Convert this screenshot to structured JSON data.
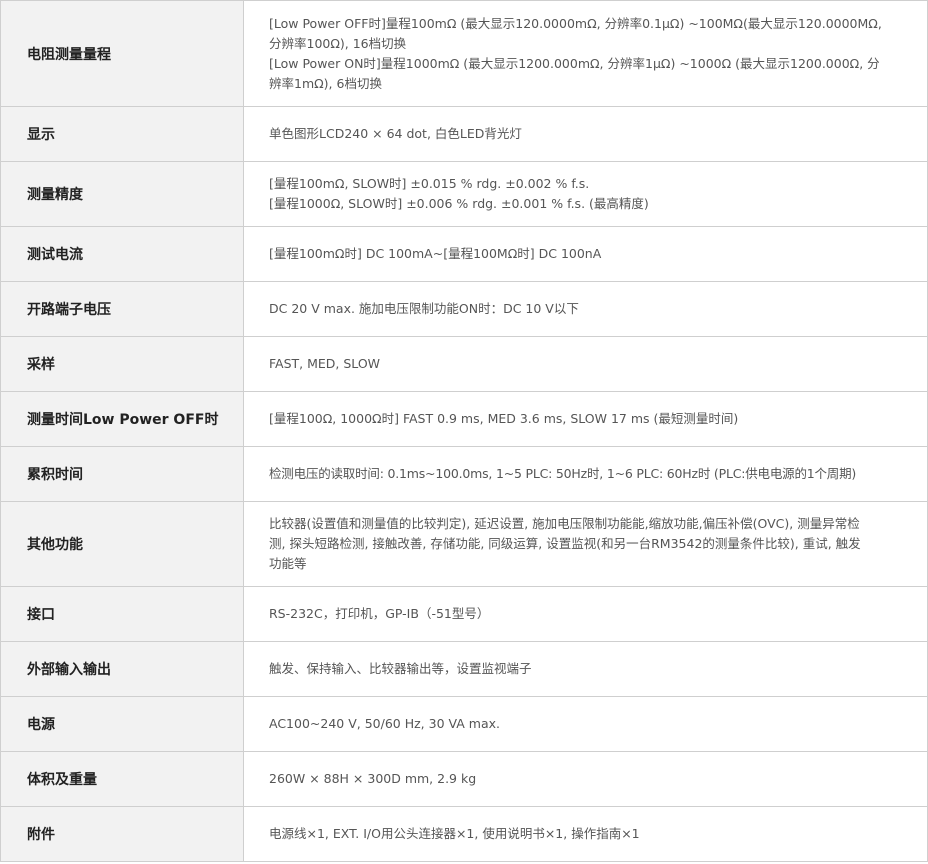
{
  "rows": [
    {
      "label": "电阻测量量程",
      "lines": [
        "[Low Power OFF时]量程100mΩ (最大显示120.0000mΩ, 分辨率0.1μΩ) ~100MΩ(最大显示120.0000MΩ,",
        "分辨率100Ω), 16档切换",
        "[Low Power ON时]量程1000mΩ (最大显示1200.000mΩ, 分辨率1μΩ) ~1000Ω (最大显示1200.000Ω, 分",
        "辨率1mΩ), 6档切换"
      ]
    },
    {
      "label": "显示",
      "lines": [
        "单色图形LCD240 × 64 dot, 白色LED背光灯"
      ]
    },
    {
      "label": "测量精度",
      "lines": [
        "[量程100mΩ, SLOW时] ±0.015 % rdg. ±0.002 % f.s.",
        "[量程1000Ω, SLOW时] ±0.006 % rdg. ±0.001 % f.s. (最高精度)"
      ]
    },
    {
      "label": "测试电流",
      "lines": [
        "[量程100mΩ时] DC 100mA~[量程100MΩ时] DC 100nA"
      ]
    },
    {
      "label": "开路端子电压",
      "lines": [
        "DC 20 V max. 施加电压限制功能ON时：DC 10 V以下"
      ]
    },
    {
      "label": "采样",
      "lines": [
        "FAST, MED, SLOW"
      ]
    },
    {
      "label": "测量时间Low Power OFF时",
      "lines": [
        "[量程100Ω, 1000Ω时] FAST 0.9 ms, MED 3.6 ms, SLOW 17 ms (最短测量时间)"
      ]
    },
    {
      "label": "累积时间",
      "lines": [
        "检测电压的读取时间: 0.1ms~100.0ms, 1~5 PLC: 50Hz时, 1~6 PLC: 60Hz时 (PLC:供电电源的1个周期)"
      ]
    },
    {
      "label": "其他功能",
      "lines": [
        "比较器(设置值和测量值的比较判定), 延迟设置, 施加电压限制功能能,缩放功能,偏压补偿(OVC), 测量异常检",
        "测, 探头短路检测, 接触改善, 存储功能, 同级运算, 设置监视(和另一台RM3542的测量条件比较), 重试, 触发",
        "功能等"
      ]
    },
    {
      "label": "接口",
      "lines": [
        "RS-232C，打印机，GP-IB（-51型号）"
      ]
    },
    {
      "label": "外部输入输出",
      "lines": [
        "触发、保持输入、比较器输出等，设置监视端子"
      ]
    },
    {
      "label": "电源",
      "lines": [
        "AC100~240 V, 50/60 Hz, 30 VA max."
      ]
    },
    {
      "label": "体积及重量",
      "lines": [
        "260W × 88H × 300D mm, 2.9 kg"
      ]
    },
    {
      "label": "附件",
      "lines": [
        "电源线×1, EXT. I/O用公头连接器×1, 使用说明书×1, 操作指南×1"
      ]
    }
  ]
}
